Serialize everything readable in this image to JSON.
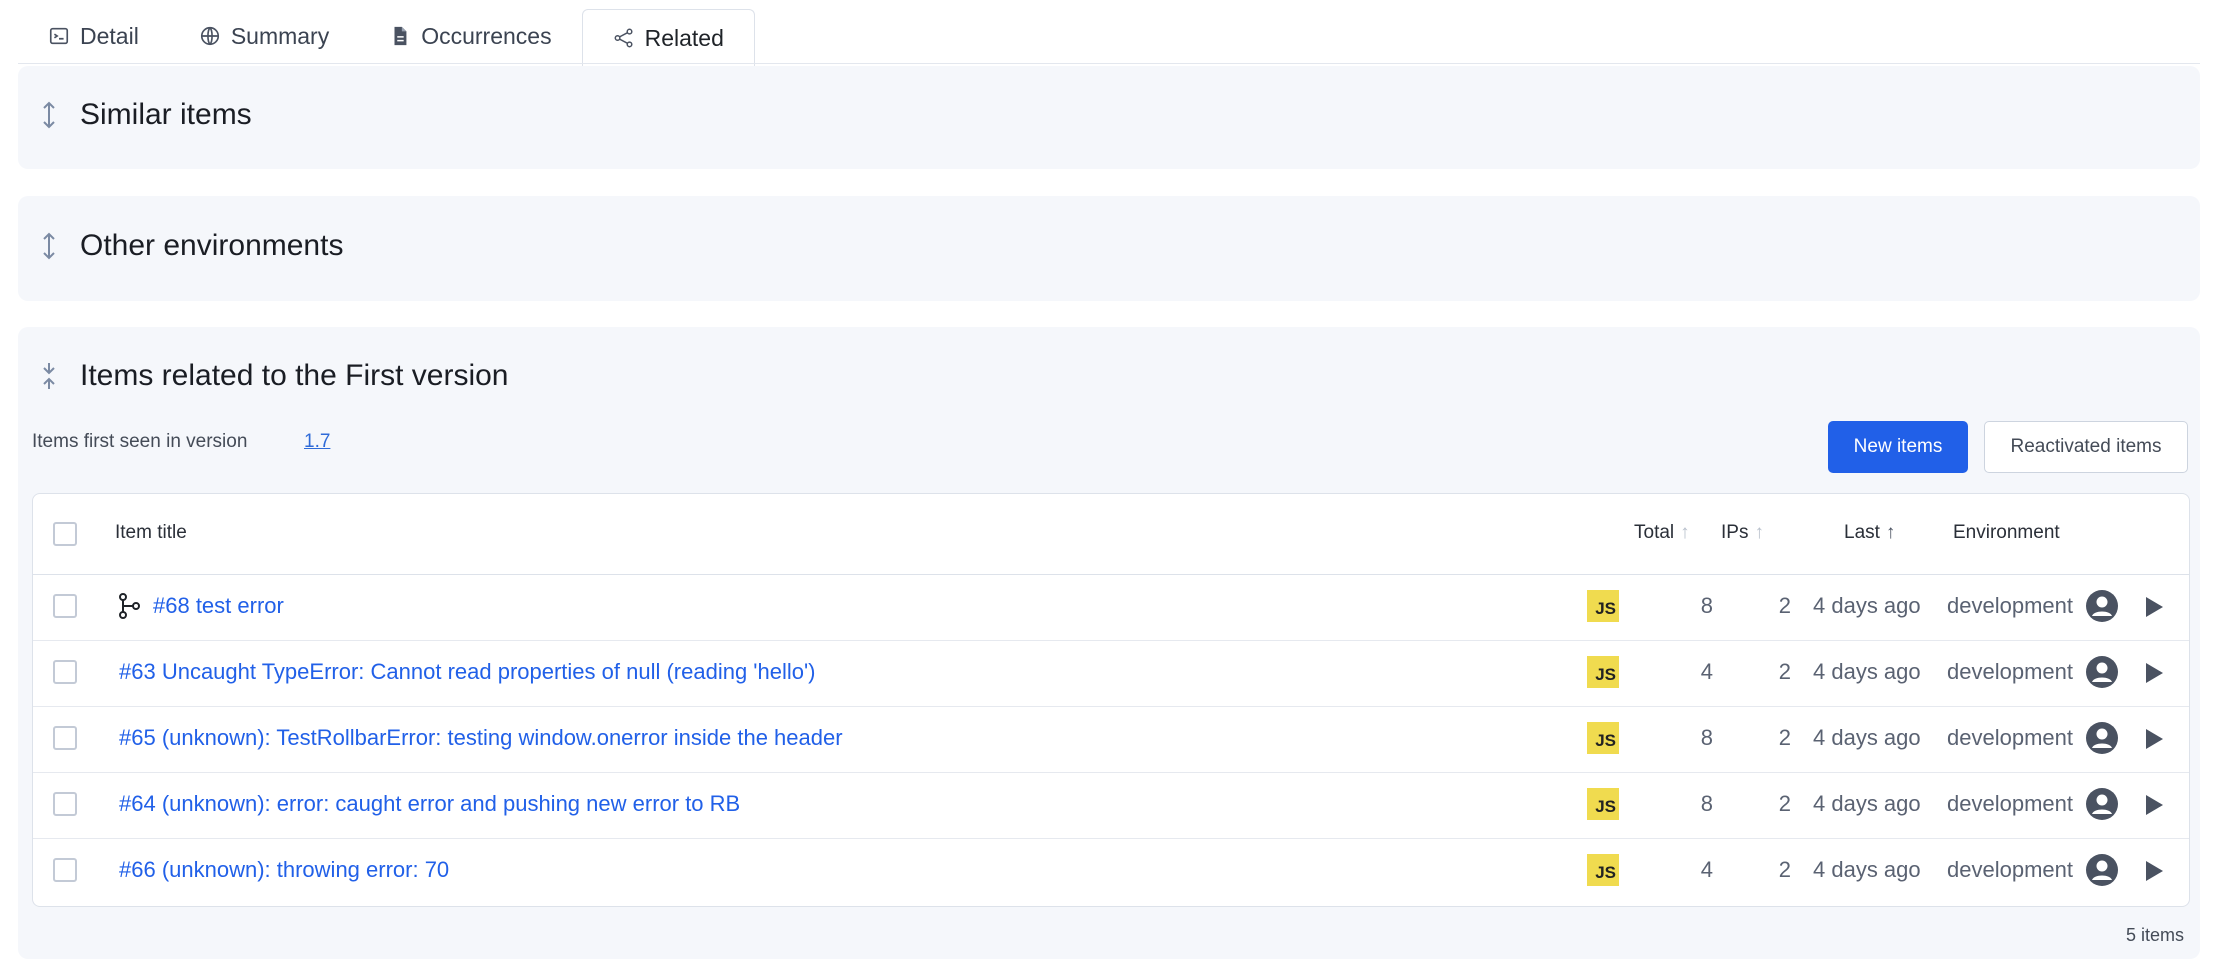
{
  "tabs": [
    {
      "label": "Detail",
      "icon": "terminal-icon",
      "active": false
    },
    {
      "label": "Summary",
      "icon": "globe-icon",
      "active": false
    },
    {
      "label": "Occurrences",
      "icon": "file-icon",
      "active": false
    },
    {
      "label": "Related",
      "icon": "share-icon",
      "active": true
    }
  ],
  "sections": {
    "similar": {
      "title": "Similar items",
      "icon": "expand-vertical-icon"
    },
    "other_envs": {
      "title": "Other environments",
      "icon": "expand-vertical-icon"
    },
    "first_version": {
      "title": "Items related to the First version",
      "icon": "collapse-vertical-icon",
      "subtitle": "Items first seen in version",
      "version": "1.7",
      "buttons": {
        "new_items": "New items",
        "reactivated_items": "Reactivated items"
      },
      "table": {
        "headers": {
          "title": "Item title",
          "total": "Total",
          "ips": "IPs",
          "last": "Last",
          "environment": "Environment"
        },
        "rows": [
          {
            "title": "#68 test error",
            "has_branch_icon": true,
            "lang": "JS",
            "total": "8",
            "ips": "2",
            "last": "4 days ago",
            "environment": "development"
          },
          {
            "title": "#63 Uncaught TypeError: Cannot read properties of null (reading 'hello')",
            "has_branch_icon": false,
            "lang": "JS",
            "total": "4",
            "ips": "2",
            "last": "4 days ago",
            "environment": "development"
          },
          {
            "title": "#65 (unknown): TestRollbarError: testing window.onerror inside the header",
            "has_branch_icon": false,
            "lang": "JS",
            "total": "8",
            "ips": "2",
            "last": "4 days ago",
            "environment": "development"
          },
          {
            "title": "#64 (unknown): error: caught error and pushing new error to RB",
            "has_branch_icon": false,
            "lang": "JS",
            "total": "8",
            "ips": "2",
            "last": "4 days ago",
            "environment": "development"
          },
          {
            "title": "#66 (unknown): throwing error: 70",
            "has_branch_icon": false,
            "lang": "JS",
            "total": "4",
            "ips": "2",
            "last": "4 days ago",
            "environment": "development"
          }
        ]
      },
      "item_count": "5 items"
    }
  },
  "colors": {
    "accent": "#2160e8",
    "js_badge": "#f0db4f",
    "section_bg": "#f5f7fb"
  }
}
